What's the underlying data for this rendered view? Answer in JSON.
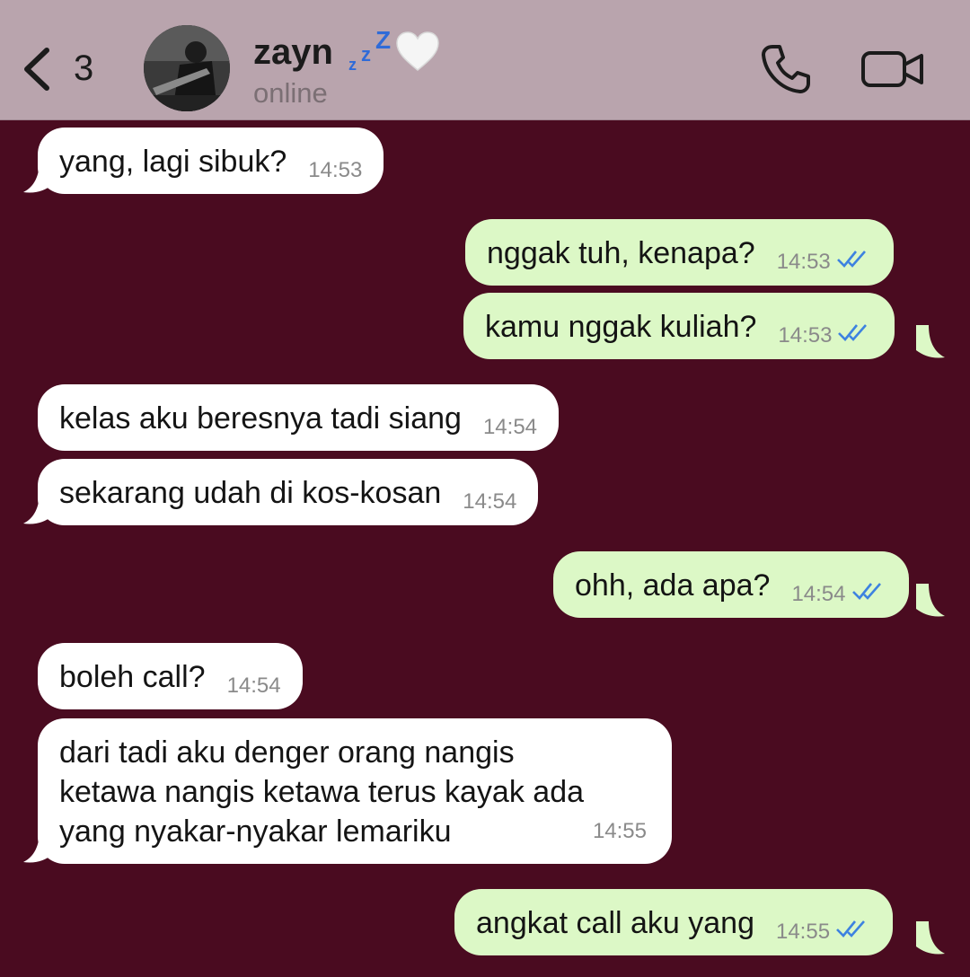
{
  "header": {
    "back_count": "3",
    "contact_name": "zayn",
    "status": "online"
  },
  "colors": {
    "background": "#4a0b20",
    "header_background": "#b9a4ad",
    "incoming_bubble": "#ffffff",
    "outgoing_bubble": "#dcf8c6",
    "read_ticks": "#3d82e0"
  },
  "messages": [
    {
      "dir": "in",
      "text": "yang, lagi sibuk?",
      "time": "14:53"
    },
    {
      "dir": "out",
      "text": "nggak tuh, kenapa?",
      "time": "14:53",
      "read": true
    },
    {
      "dir": "out",
      "text": "kamu nggak kuliah?",
      "time": "14:53",
      "read": true
    },
    {
      "dir": "in",
      "text": "kelas aku beresnya tadi siang",
      "time": "14:54"
    },
    {
      "dir": "in",
      "text": "sekarang udah di kos-kosan",
      "time": "14:54"
    },
    {
      "dir": "out",
      "text": "ohh, ada apa?",
      "time": "14:54",
      "read": true
    },
    {
      "dir": "in",
      "text": "boleh call?",
      "time": "14:54"
    },
    {
      "dir": "in",
      "text_lines": [
        "dari tadi aku denger orang nangis",
        "ketawa nangis ketawa terus kayak ada",
        "yang nyakar-nyakar lemariku"
      ],
      "time": "14:55"
    },
    {
      "dir": "out",
      "text": "angkat call aku yang",
      "time": "14:55",
      "read": true
    }
  ]
}
